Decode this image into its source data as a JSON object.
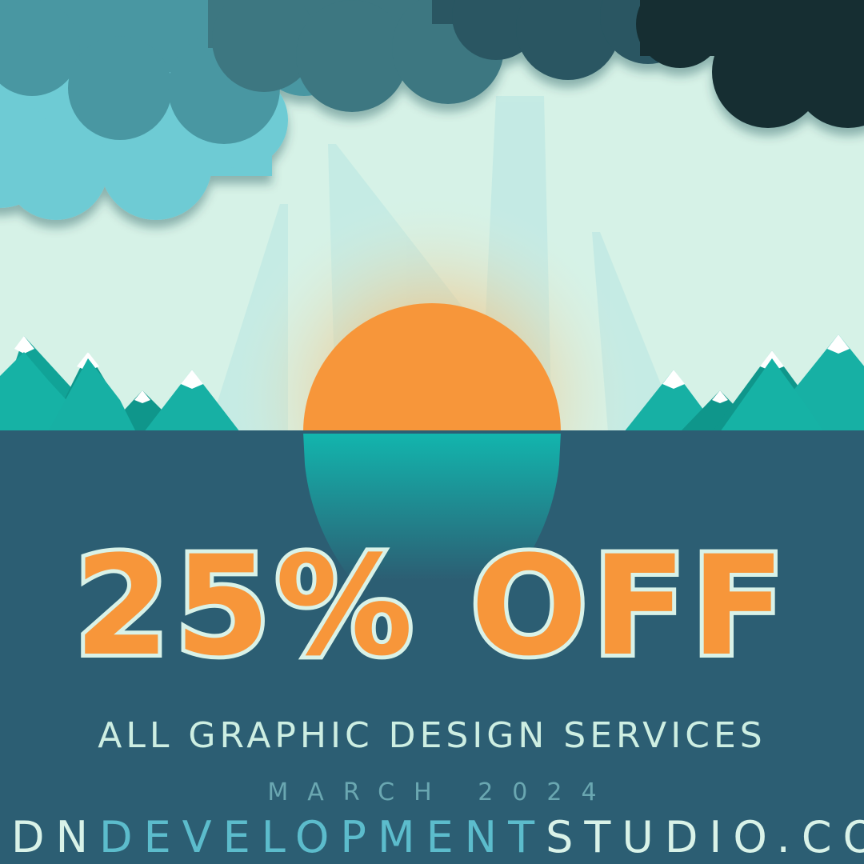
{
  "promo": {
    "headline": "25% OFF",
    "subheadline": "ALL GRAPHIC DESIGN SERVICES",
    "date": "MARCH 2024",
    "website": {
      "part1": "DN",
      "part2": "DEVELOPMENT",
      "part3": "STUDIO.COM"
    }
  },
  "colors": {
    "sky": "#d6f2e7",
    "water": "#2c5e73",
    "sun": "#f7963a",
    "mountain": "#17b0a4",
    "headline_outline": "#d9f2e8",
    "website_accent": "#5cbccc"
  }
}
